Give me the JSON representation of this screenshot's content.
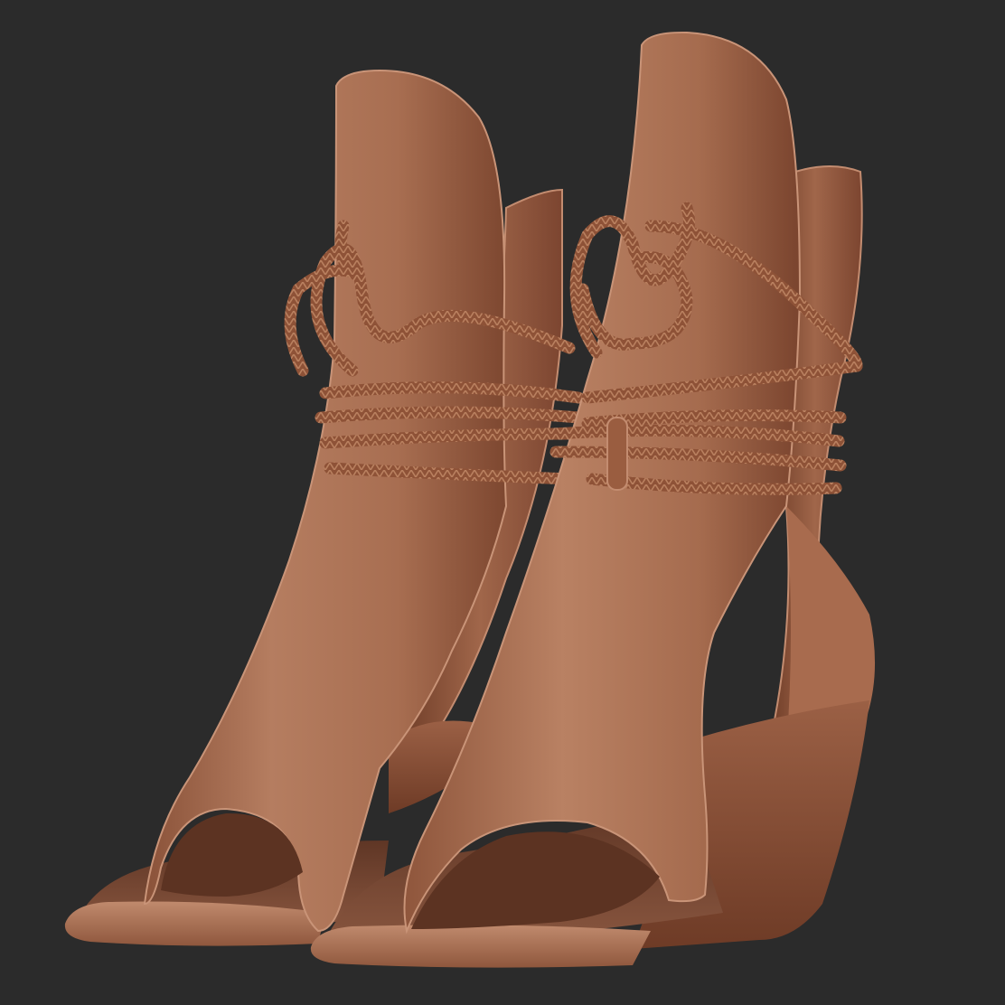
{
  "scene": {
    "subject": "pair-of-lace-up-wedge-sandals",
    "background_color": "#2b2b2b",
    "material_colors": {
      "leather_light": "#b47a5c",
      "leather_mid": "#9a5f43",
      "leather_dark": "#6a3a26",
      "rope": "#8e5237",
      "rope_highlight": "#b9805f",
      "sole": "#a86c4f",
      "footbed": "#7a4b36"
    }
  }
}
